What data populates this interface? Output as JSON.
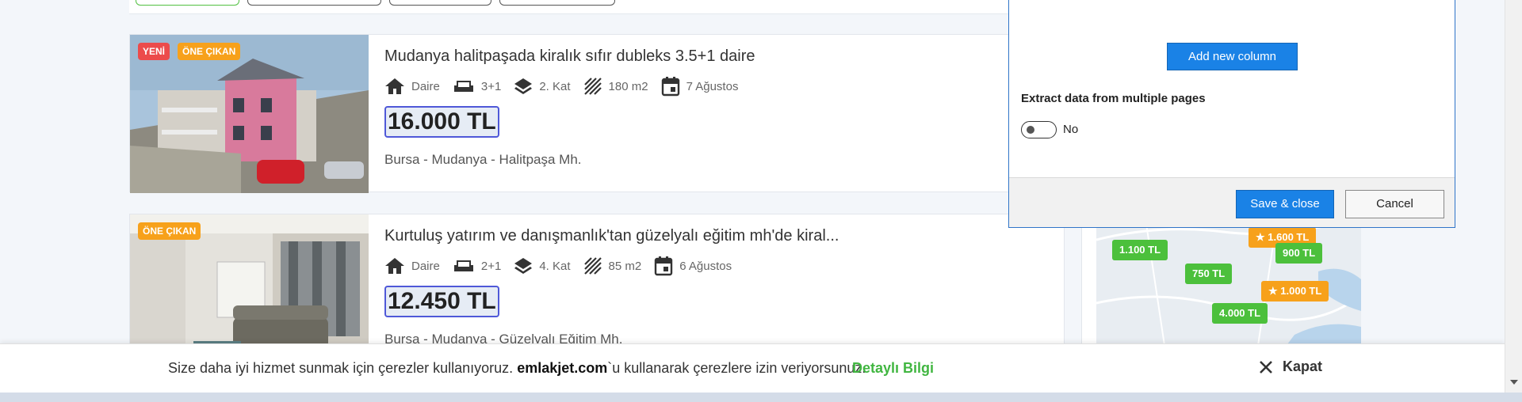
{
  "listings": [
    {
      "badges": [
        {
          "label": "YENİ",
          "type": "new"
        },
        {
          "label": "ÖNE ÇIKAN",
          "type": "featured"
        }
      ],
      "title": "Mudanya halitpaşada kiralık sıfır dubleks 3.5+1 daire",
      "features": {
        "type": "Daire",
        "rooms": "3+1",
        "floor": "2. Kat",
        "area": "180 m2",
        "date": "7 Ağustos"
      },
      "price": "16.000 TL",
      "location": "Bursa - Mudanya - Halitpaşa Mh."
    },
    {
      "badges": [
        {
          "label": "ÖNE ÇIKAN",
          "type": "featured"
        }
      ],
      "title": "Kurtuluş yatırım ve danışmanlık'tan güzelyalı eğitim mh'de kiral...",
      "features": {
        "type": "Daire",
        "rooms": "2+1",
        "floor": "4. Kat",
        "area": "85 m2",
        "date": "6 Ağustos"
      },
      "price": "12.450 TL",
      "location": "Bursa - Mudanya - Güzelyalı Eğitim Mh."
    }
  ],
  "map": {
    "pins": [
      {
        "label": "1.600 TL",
        "color": "orange",
        "starred": true
      },
      {
        "label": "1.100 TL",
        "color": "green",
        "starred": false
      },
      {
        "label": "900 TL",
        "color": "green",
        "starred": false
      },
      {
        "label": "750 TL",
        "color": "green",
        "starred": false
      },
      {
        "label": "1.000 TL",
        "color": "orange",
        "starred": true
      },
      {
        "label": "4.000 TL",
        "color": "green",
        "starred": false
      }
    ]
  },
  "dialog": {
    "add_column_label": "Add new column",
    "multi_page_label": "Extract data from multiple pages",
    "multi_page_value": "No",
    "multi_page_enabled": false,
    "save_label": "Save & close",
    "cancel_label": "Cancel"
  },
  "cookie": {
    "text_before": "Size daha iyi hizmet sunmak için çerezler kullanıyoruz.",
    "site": "emlakjet.com",
    "text_after": "`u kullanarak çerezlere izin veriyorsunuz.",
    "link_label": "Detaylı Bilgi",
    "close_label": "Kapat"
  },
  "colors": {
    "accent_blue": "#1a82e6",
    "price_border": "#4f58d8",
    "badge_new": "#ec4b4b",
    "badge_featured": "#f7a11b",
    "pin_green": "#4cc03c",
    "link_green": "#41b641"
  },
  "icons": [
    "home-icon",
    "sofa-icon",
    "layers-icon",
    "area-hatch-icon",
    "calendar-icon",
    "close-x-icon",
    "star-icon"
  ]
}
